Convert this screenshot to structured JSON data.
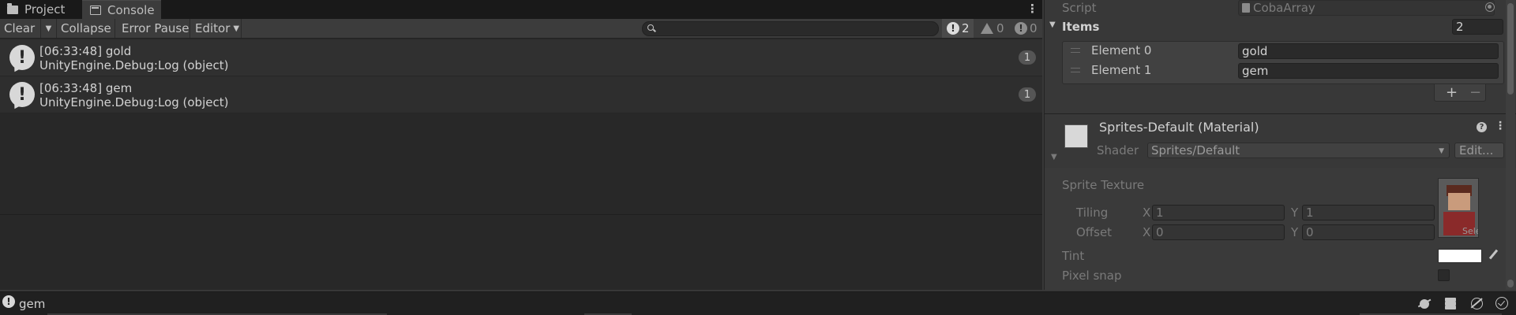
{
  "tabs": [
    {
      "label": "Project",
      "icon": "folder-icon"
    },
    {
      "label": "Console",
      "icon": "console-icon"
    }
  ],
  "toolbar": {
    "clear_label": "Clear",
    "collapse_label": "Collapse",
    "error_pause_label": "Error Pause",
    "editor_label": "Editor",
    "search_placeholder": "",
    "info_count": "2",
    "warning_count": "0",
    "error_count": "0"
  },
  "logs": [
    {
      "line1": "[06:33:48] gold",
      "line2": "UnityEngine.Debug:Log (object)",
      "count": "1"
    },
    {
      "line1": "[06:33:48] gem",
      "line2": "UnityEngine.Debug:Log (object)",
      "count": "1"
    }
  ],
  "inspector": {
    "script_label": "Script",
    "script_value": "CobaArray",
    "items_label": "Items",
    "items_size": "2",
    "elements": [
      {
        "label": "Element 0",
        "value": "gold"
      },
      {
        "label": "Element 1",
        "value": "gem"
      }
    ],
    "add_label": "+",
    "remove_label": "−",
    "material": {
      "title": "Sprites-Default (Material)",
      "shader_label": "Shader",
      "shader_value": "Sprites/Default",
      "edit_label": "Edit...",
      "sprite_texture_label": "Sprite Texture",
      "select_label": "Select",
      "tiling_label": "Tiling",
      "offset_label": "Offset",
      "tiling": {
        "x_label": "X",
        "x": "1",
        "y_label": "Y",
        "y": "1"
      },
      "offset": {
        "x_label": "X",
        "x": "0",
        "y_label": "Y",
        "y": "0"
      },
      "tint_label": "Tint",
      "tint_color": "#ffffff",
      "pixel_snap_label": "Pixel snap"
    }
  },
  "status": {
    "message": "gem"
  },
  "colors": {
    "panel_bg": "#282828",
    "inspector_bg": "#383838",
    "statusbar_bg": "#202020"
  }
}
